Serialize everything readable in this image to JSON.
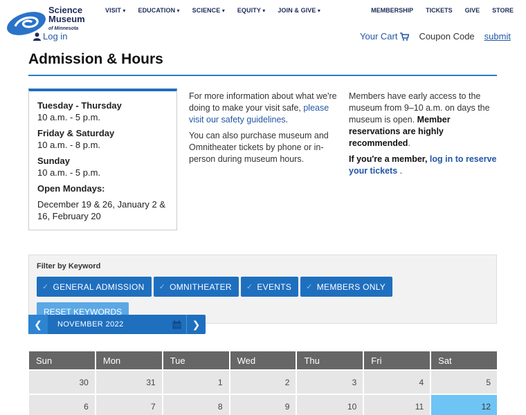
{
  "logo": {
    "line1": "Science",
    "line2": "Museum",
    "line3": "of Minnesota"
  },
  "nav": {
    "left": [
      "VISIT",
      "EDUCATION",
      "SCIENCE",
      "EQUITY",
      "JOIN & GIVE"
    ],
    "right": [
      "MEMBERSHIP",
      "TICKETS",
      "GIVE",
      "STORE"
    ]
  },
  "login": {
    "label": "Log in"
  },
  "cart": {
    "label": "Your Cart",
    "coupon": "Coupon Code",
    "submit": "submit"
  },
  "page": {
    "title": "Admission & Hours"
  },
  "hours": {
    "d1": "Tuesday - Thursday",
    "t1": "10 a.m. - 5 p.m.",
    "d2": "Friday & Saturday",
    "t2": "10 a.m. - 8 p.m.",
    "d3": "Sunday",
    "t3": "10 a.m. - 5 p.m.",
    "d4": "Open Mondays:",
    "t4": "December 19 & 26, January 2 & 16, February 20"
  },
  "info": {
    "p1a": "For more information about what we're doing to make your visit safe, ",
    "p1link": "please visit our safety guidelines",
    "p1b": ".",
    "p2": "You can also purchase museum and Omnitheater tickets by phone or in-person during museum hours."
  },
  "members": {
    "p1a": "Members have early access to the museum from 9–10 a.m. on days the museum is open. ",
    "p1bold": "Member reservations are highly recommended",
    "p1b": ".",
    "p2bold": "If you're a member, ",
    "p2link": "log in to reserve your tickets",
    "p2b": " ."
  },
  "filter": {
    "label": "Filter by Keyword",
    "keywords": [
      "GENERAL ADMISSION",
      "OMNITHEATER",
      "EVENTS",
      "MEMBERS ONLY"
    ],
    "reset": "RESET KEYWORDS"
  },
  "calendar": {
    "month": "NOVEMBER 2022",
    "weekdays": [
      "Sun",
      "Mon",
      "Tue",
      "Wed",
      "Thu",
      "Fri",
      "Sat"
    ],
    "row1": [
      "30",
      "31",
      "1",
      "2",
      "3",
      "4",
      "5"
    ],
    "row2": [
      "6",
      "7",
      "8",
      "9",
      "10",
      "11",
      "12"
    ]
  },
  "colors": {
    "accent": "#1f6fbf",
    "today": "#6ec4f5",
    "link": "#2156a5"
  }
}
